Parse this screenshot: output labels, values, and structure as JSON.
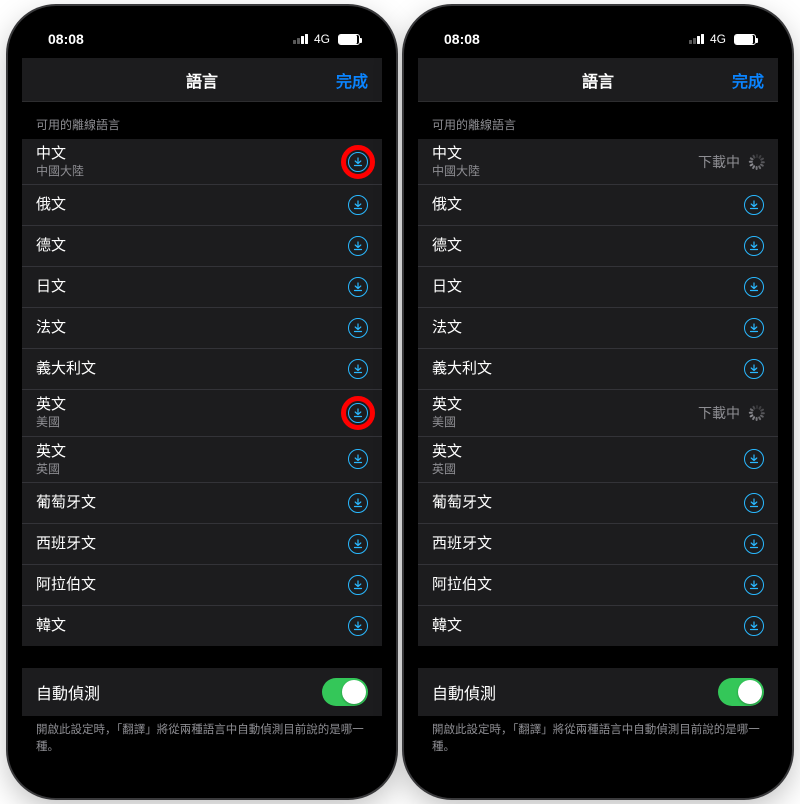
{
  "status": {
    "time": "08:08",
    "network": "4G"
  },
  "nav": {
    "title": "語言",
    "done": "完成"
  },
  "section_header": "可用的離線語言",
  "downloading_label": "下載中",
  "languages": [
    {
      "name": "中文",
      "region": "中國大陸"
    },
    {
      "name": "俄文",
      "region": ""
    },
    {
      "name": "德文",
      "region": ""
    },
    {
      "name": "日文",
      "region": ""
    },
    {
      "name": "法文",
      "region": ""
    },
    {
      "name": "義大利文",
      "region": ""
    },
    {
      "name": "英文",
      "region": "美國"
    },
    {
      "name": "英文",
      "region": "英國"
    },
    {
      "name": "葡萄牙文",
      "region": ""
    },
    {
      "name": "西班牙文",
      "region": ""
    },
    {
      "name": "阿拉伯文",
      "region": ""
    },
    {
      "name": "韓文",
      "region": ""
    }
  ],
  "left_annotations": {
    "highlight_download_indices": [
      0,
      6
    ]
  },
  "right_downloading_indices": [
    0,
    6
  ],
  "toggle": {
    "label": "自動偵測",
    "on": true
  },
  "footer": "開啟此設定時，「翻譯」將從兩種語言中自動偵測目前說的是哪一種。"
}
